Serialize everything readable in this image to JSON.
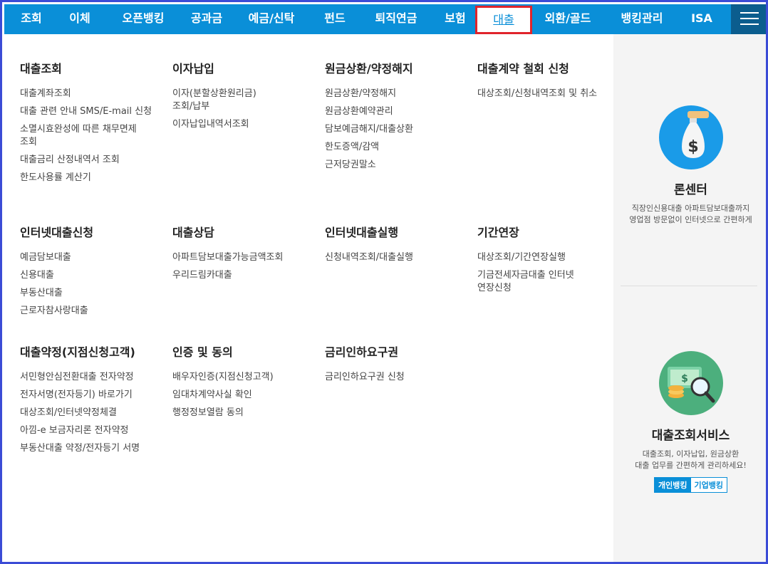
{
  "nav": {
    "items": [
      "조회",
      "이체",
      "오픈뱅킹",
      "공과금",
      "예금/신탁",
      "펀드",
      "퇴직연금",
      "보험",
      "대출",
      "외환/골드",
      "뱅킹관리",
      "ISA"
    ],
    "active": "대출"
  },
  "menu": {
    "sections": [
      {
        "title": "대출조회",
        "links": [
          "대출계좌조회",
          "대출 관련 안내 SMS/E-mail 신청",
          "소멸시효완성에 따른 채무면제 조회",
          "대출금리 산정내역서 조회",
          "한도사용률 계산기"
        ]
      },
      {
        "title": "이자납입",
        "links": [
          "이자(분할상환원리금) 조회/납부",
          "이자납입내역서조회"
        ]
      },
      {
        "title": "원금상환/약정해지",
        "links": [
          "원금상환/약정해지",
          "원금상환예약관리",
          "담보예금해지/대출상환",
          "한도증액/감액",
          "근저당권말소"
        ]
      },
      {
        "title": "대출계약 철회 신청",
        "links": [
          "대상조회/신청내역조회 및 취소"
        ]
      },
      {
        "title": "인터넷대출신청",
        "links": [
          "예금담보대출",
          "신용대출",
          "부동산대출",
          "근로자참사랑대출"
        ]
      },
      {
        "title": "대출상담",
        "links": [
          "아파트담보대출가능금액조회",
          "우리드림카대출"
        ]
      },
      {
        "title": "인터넷대출실행",
        "links": [
          "신청내역조회/대출실행"
        ]
      },
      {
        "title": "기간연장",
        "links": [
          "대상조회/기간연장실행",
          "기금전세자금대출 인터넷 연장신청"
        ]
      },
      {
        "title": "대출약정(지점신청고객)",
        "links": [
          "서민형안심전환대출 전자약정",
          "전자서명(전자등기) 바로가기",
          "대상조회/인터넷약정체결",
          "아낌-e 보금자리론 전자약정",
          "부동산대출 약정/전자등기 서명"
        ]
      },
      {
        "title": "인증 및 동의",
        "links": [
          "배우자인증(지점신청고객)",
          "임대차계약사실 확인",
          "행정정보열람 동의"
        ]
      },
      {
        "title": "금리인하요구권",
        "links": [
          "금리인하요구권 신청"
        ]
      }
    ]
  },
  "side": {
    "loan_center": {
      "title": "론센터",
      "desc1": "직장인신용대출 아파트담보대출까지",
      "desc2": "영업점 방문없이 인터넷으로 간편하게",
      "icon": "money-bag-icon"
    },
    "loan_service": {
      "title": "대출조회서비스",
      "desc1": "대출조회, 이자납입, 원금상환",
      "desc2": "대출 업무를 간편하게 관리하세요!",
      "icon": "magnifier-money-icon",
      "btn_personal": "개인뱅킹",
      "btn_corporate": "기업뱅킹"
    }
  },
  "colors": {
    "nav_bg": "#0a8fd8",
    "menu_btn_bg": "#0b5d8e",
    "active_border": "#e0242b",
    "frame": "#3b4bd6"
  }
}
